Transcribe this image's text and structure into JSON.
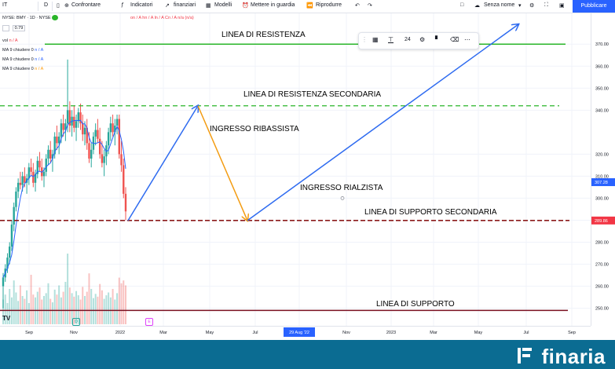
{
  "toolbar": {
    "symbol": "IT",
    "interval": "D",
    "compare": "Confrontare",
    "indicators": "Indicatori",
    "financials": "finanziari",
    "templates": "Modelli",
    "alert": "Mettere in guardia",
    "replay": "Riprodurre",
    "no_name": "Senza nome",
    "publish": "Pubblicare"
  },
  "legend": {
    "title": "NYSE: BMY · 1D · NYSE",
    "ohlc": "on / A hn / A ln / A Cn / A n/a (n/a)",
    "value_box": "0.79",
    "vol": "vol",
    "vol_val": "n / A",
    "ma1": "MA 9 chiudere 0",
    "ma1_val": "n / A",
    "ma2": "MA 9 chiudere 0",
    "ma2_val": "n / A",
    "ma3": "MA 9 chiudere 0",
    "ma3_val": "n / A"
  },
  "drawing_toolbar": {
    "width_value": "24"
  },
  "colors": {
    "up": "#26a69a",
    "down": "#ef5350",
    "resistance": "#2ab52a",
    "support": "#7a1020",
    "secondary_support": "#8b1a1a",
    "arrow_blue": "#2e6bf0",
    "arrow_orange": "#f39c12",
    "price_badge_blue": "#2962ff",
    "price_badge_red": "#f23645",
    "footer": "#0b6c92"
  },
  "annotations": {
    "resistance": "LINEA DI RESISTENZA",
    "secondary_resistance": "LINEA DI RESISTENZA SECONDARIA",
    "bearish_entry": "INGRESSO RIBASSISTA",
    "bullish_entry": "INGRESSO RIALZISTA",
    "secondary_support": "LINEA DI SUPPORTO SECONDARIA",
    "support": "LINEA DI SUPPORTO"
  },
  "chart_data": {
    "type": "candlestick",
    "ylim": [
      242,
      384
    ],
    "y_ticks": [
      250,
      260,
      270,
      280,
      290,
      300,
      310,
      320,
      340,
      350,
      360,
      370
    ],
    "x_labels": [
      "Sep",
      "Nov",
      "2022",
      "Mar",
      "May",
      "Jul",
      "29 Aug '22",
      "Nov",
      "2023",
      "Mar",
      "May",
      "Jul",
      "Sep"
    ],
    "highlighted_x_label": "29 Aug '22",
    "last_price": 307.28,
    "crosshair_price": 289.86,
    "levels": {
      "resistance": 370,
      "secondary_resistance": 342,
      "secondary_support": 289.86,
      "support": 249
    },
    "candles": [
      {
        "o": 260,
        "h": 266,
        "l": 250,
        "c": 264
      },
      {
        "o": 264,
        "h": 270,
        "l": 262,
        "c": 268
      },
      {
        "o": 268,
        "h": 275,
        "l": 266,
        "c": 273
      },
      {
        "o": 273,
        "h": 280,
        "l": 270,
        "c": 278
      },
      {
        "o": 278,
        "h": 290,
        "l": 276,
        "c": 288
      },
      {
        "o": 288,
        "h": 298,
        "l": 285,
        "c": 296
      },
      {
        "o": 296,
        "h": 305,
        "l": 294,
        "c": 303
      },
      {
        "o": 303,
        "h": 309,
        "l": 300,
        "c": 307
      },
      {
        "o": 307,
        "h": 312,
        "l": 304,
        "c": 306
      },
      {
        "o": 306,
        "h": 312,
        "l": 303,
        "c": 310
      },
      {
        "o": 310,
        "h": 314,
        "l": 305,
        "c": 307
      },
      {
        "o": 307,
        "h": 311,
        "l": 302,
        "c": 309
      },
      {
        "o": 309,
        "h": 316,
        "l": 306,
        "c": 314
      },
      {
        "o": 314,
        "h": 318,
        "l": 310,
        "c": 312
      },
      {
        "o": 312,
        "h": 316,
        "l": 305,
        "c": 307
      },
      {
        "o": 307,
        "h": 313,
        "l": 303,
        "c": 311
      },
      {
        "o": 311,
        "h": 319,
        "l": 309,
        "c": 317
      },
      {
        "o": 317,
        "h": 321,
        "l": 312,
        "c": 314
      },
      {
        "o": 314,
        "h": 318,
        "l": 308,
        "c": 310
      },
      {
        "o": 310,
        "h": 314,
        "l": 305,
        "c": 312
      },
      {
        "o": 312,
        "h": 320,
        "l": 310,
        "c": 318
      },
      {
        "o": 318,
        "h": 324,
        "l": 315,
        "c": 322
      },
      {
        "o": 322,
        "h": 326,
        "l": 316,
        "c": 318
      },
      {
        "o": 318,
        "h": 322,
        "l": 312,
        "c": 320
      },
      {
        "o": 320,
        "h": 330,
        "l": 318,
        "c": 328
      },
      {
        "o": 328,
        "h": 333,
        "l": 322,
        "c": 325
      },
      {
        "o": 325,
        "h": 330,
        "l": 320,
        "c": 328
      },
      {
        "o": 328,
        "h": 336,
        "l": 325,
        "c": 334
      },
      {
        "o": 334,
        "h": 338,
        "l": 328,
        "c": 331
      },
      {
        "o": 331,
        "h": 336,
        "l": 326,
        "c": 334
      },
      {
        "o": 334,
        "h": 363,
        "l": 330,
        "c": 340
      },
      {
        "o": 340,
        "h": 344,
        "l": 330,
        "c": 333
      },
      {
        "o": 333,
        "h": 340,
        "l": 328,
        "c": 337
      },
      {
        "o": 337,
        "h": 342,
        "l": 330,
        "c": 332
      },
      {
        "o": 332,
        "h": 338,
        "l": 326,
        "c": 335
      },
      {
        "o": 335,
        "h": 341,
        "l": 332,
        "c": 339
      },
      {
        "o": 339,
        "h": 343,
        "l": 331,
        "c": 334
      },
      {
        "o": 334,
        "h": 338,
        "l": 326,
        "c": 329
      },
      {
        "o": 329,
        "h": 335,
        "l": 324,
        "c": 332
      },
      {
        "o": 332,
        "h": 336,
        "l": 322,
        "c": 325
      },
      {
        "o": 325,
        "h": 330,
        "l": 316,
        "c": 318
      },
      {
        "o": 318,
        "h": 325,
        "l": 314,
        "c": 322
      },
      {
        "o": 322,
        "h": 330,
        "l": 320,
        "c": 328
      },
      {
        "o": 328,
        "h": 334,
        "l": 324,
        "c": 331
      },
      {
        "o": 331,
        "h": 336,
        "l": 325,
        "c": 327
      },
      {
        "o": 327,
        "h": 332,
        "l": 318,
        "c": 320
      },
      {
        "o": 320,
        "h": 326,
        "l": 314,
        "c": 316
      },
      {
        "o": 316,
        "h": 322,
        "l": 310,
        "c": 319
      },
      {
        "o": 319,
        "h": 326,
        "l": 315,
        "c": 324
      },
      {
        "o": 324,
        "h": 332,
        "l": 320,
        "c": 330
      },
      {
        "o": 330,
        "h": 337,
        "l": 326,
        "c": 334
      },
      {
        "o": 334,
        "h": 338,
        "l": 328,
        "c": 330
      },
      {
        "o": 330,
        "h": 336,
        "l": 324,
        "c": 333
      },
      {
        "o": 333,
        "h": 338,
        "l": 329,
        "c": 336
      },
      {
        "o": 336,
        "h": 338,
        "l": 318,
        "c": 320
      },
      {
        "o": 320,
        "h": 326,
        "l": 312,
        "c": 315
      },
      {
        "o": 315,
        "h": 318,
        "l": 300,
        "c": 302
      },
      {
        "o": 302,
        "h": 305,
        "l": 290,
        "c": 294
      }
    ],
    "volumes": [
      0.35,
      0.42,
      0.3,
      0.5,
      0.38,
      0.62,
      0.45,
      0.33,
      0.55,
      0.4,
      0.36,
      0.48,
      0.3,
      0.7,
      0.42,
      0.38,
      0.46,
      0.52,
      0.35,
      0.4,
      0.44,
      0.58,
      0.36,
      0.31,
      0.49,
      0.42,
      0.55,
      0.38,
      0.46,
      0.6,
      1.0,
      0.52,
      0.44,
      0.39,
      0.47,
      0.41,
      0.35,
      0.53,
      0.4,
      0.46,
      0.72,
      0.5,
      0.37,
      0.43,
      0.39,
      0.57,
      0.48,
      0.36,
      0.41,
      0.45,
      0.38,
      0.5,
      0.35,
      0.44,
      0.66,
      0.58,
      0.62,
      0.55
    ]
  }
}
